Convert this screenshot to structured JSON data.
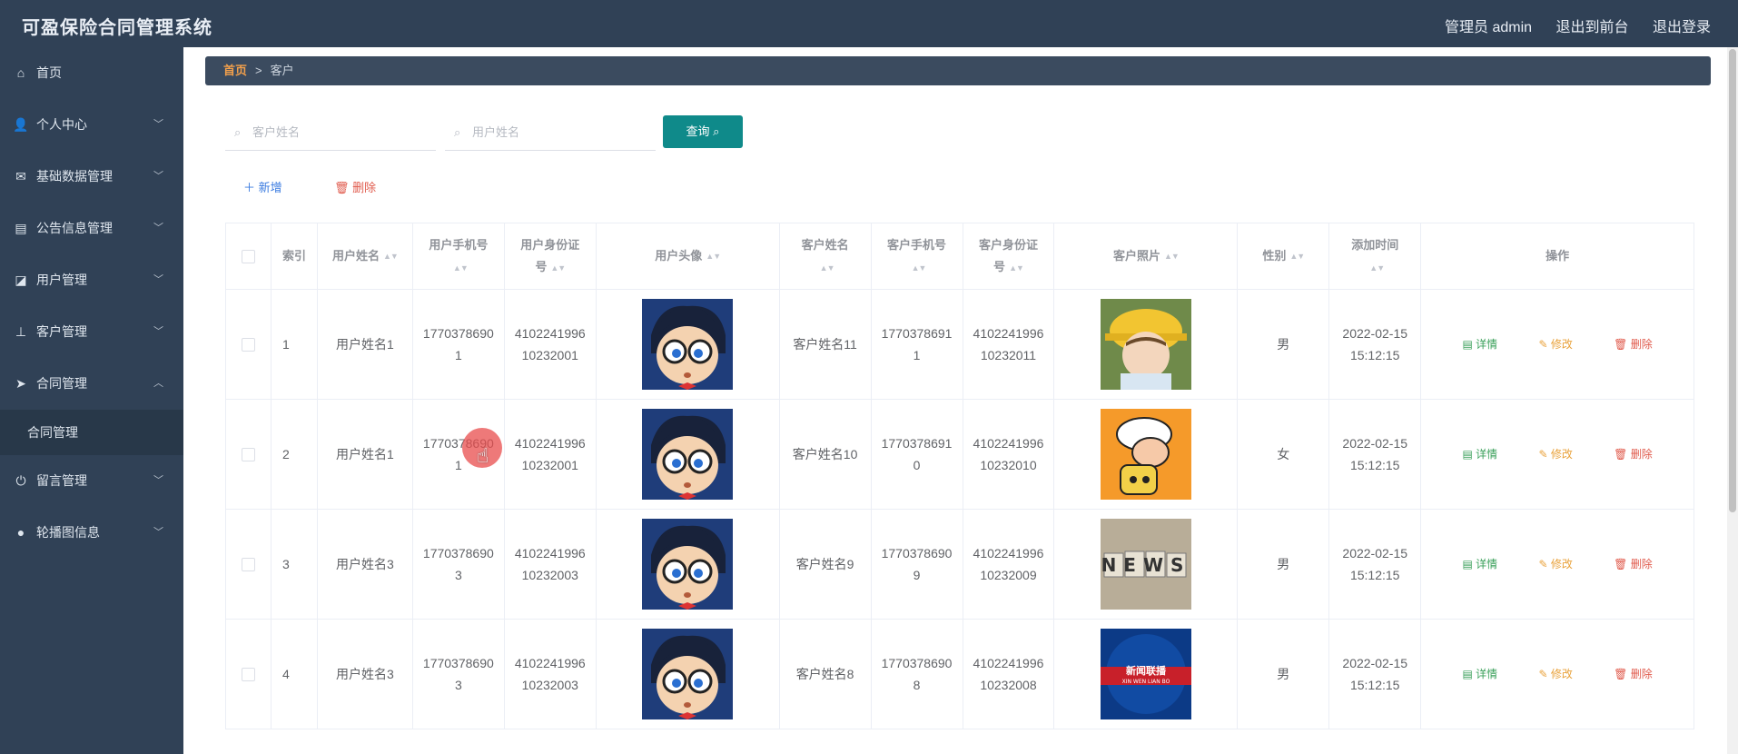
{
  "header": {
    "app_title": "可盈保险合同管理系统",
    "admin_label": "管理员 admin",
    "front_label": "退出到前台",
    "logout_label": "退出登录"
  },
  "sidebar": {
    "items": [
      {
        "label": "首页",
        "icon": "home-icon",
        "arrow": ""
      },
      {
        "label": "个人中心",
        "icon": "user-icon",
        "arrow": "﹀"
      },
      {
        "label": "基础数据管理",
        "icon": "mail-icon",
        "arrow": "﹀"
      },
      {
        "label": "公告信息管理",
        "icon": "clipboard-icon",
        "arrow": "﹀"
      },
      {
        "label": "用户管理",
        "icon": "chart-icon",
        "arrow": "﹀"
      },
      {
        "label": "客户管理",
        "icon": "stamp-icon",
        "arrow": "﹀"
      },
      {
        "label": "合同管理",
        "icon": "send-icon",
        "arrow": "︿"
      },
      {
        "label": "合同管理",
        "icon": "",
        "arrow": "",
        "sub": true
      },
      {
        "label": "留言管理",
        "icon": "power-icon",
        "arrow": "﹀"
      },
      {
        "label": "轮播图信息",
        "icon": "pin-icon",
        "arrow": "﹀"
      }
    ]
  },
  "breadcrumb": {
    "home": "首页",
    "separator": ">",
    "current": "客户"
  },
  "search": {
    "customer_placeholder": "客户姓名",
    "user_placeholder": "用户姓名",
    "query_label": "查询 ⌕"
  },
  "toolbar": {
    "add_label": "＋ 新增",
    "delete_label": "🗑 删除"
  },
  "table": {
    "columns": [
      "索引",
      "用户姓名",
      "用户手机号",
      "用户身份证号",
      "用户头像",
      "客户姓名",
      "客户手机号",
      "客户身份证号",
      "客户照片",
      "性别",
      "添加时间",
      "操作"
    ],
    "sort_glyph": "▲▼",
    "rows": [
      {
        "index": "1",
        "user_name": "用户姓名1",
        "user_phone": "17703786901",
        "user_id": "410224199610232001",
        "customer_name": "客户姓名11",
        "customer_phone": "17703786911",
        "customer_id": "410224199610232011",
        "gender": "男",
        "added": "2022-02-15 15:12:15",
        "photo": "cartoon-yellow-hat"
      },
      {
        "index": "2",
        "user_name": "用户姓名1",
        "user_phone": "17703786901",
        "user_id": "410224199610232001",
        "customer_name": "客户姓名10",
        "customer_phone": "17703786910",
        "customer_id": "410224199610232010",
        "gender": "女",
        "added": "2022-02-15 15:12:15",
        "photo": "cartoon-orange"
      },
      {
        "index": "3",
        "user_name": "用户姓名3",
        "user_phone": "17703786903",
        "user_id": "410224199610232003",
        "customer_name": "客户姓名9",
        "customer_phone": "17703786909",
        "customer_id": "410224199610232009",
        "gender": "男",
        "added": "2022-02-15 15:12:15",
        "photo": "news-blocks"
      },
      {
        "index": "4",
        "user_name": "用户姓名3",
        "user_phone": "17703786903",
        "user_id": "410224199610232003",
        "customer_name": "客户姓名8",
        "customer_phone": "17703786908",
        "customer_id": "410224199610232008",
        "gender": "男",
        "added": "2022-02-15 15:12:15",
        "photo": "news-broadcast"
      }
    ],
    "ops": {
      "detail": "详情",
      "edit": "修改",
      "remove": "删除"
    },
    "photo_texts": {
      "news": "NEWS",
      "broadcast_cn": "新闻联播",
      "broadcast_en": "XIN WEN LIAN BO"
    }
  }
}
